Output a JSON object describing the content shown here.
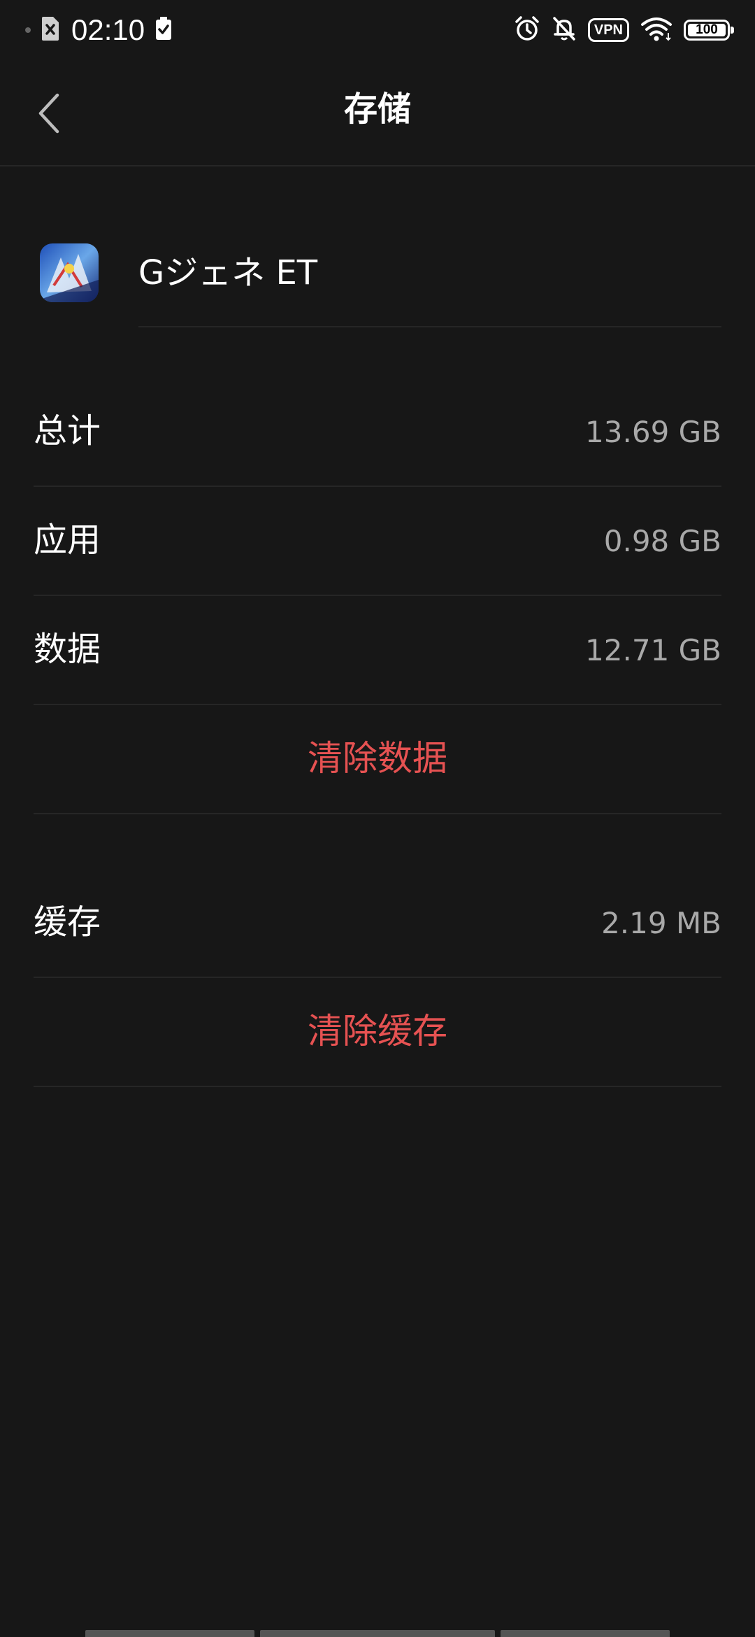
{
  "status_bar": {
    "time": "02:10",
    "vpn_label": "VPN",
    "battery_level": "100",
    "icons": [
      "sim-off-icon",
      "battery-saver-icon",
      "alarm-icon",
      "notifications-off-icon",
      "vpn-icon",
      "wifi-icon",
      "battery-icon"
    ]
  },
  "header": {
    "title": "存储",
    "back_icon": "chevron-left-icon"
  },
  "app": {
    "name": "Gジェネ ET",
    "icon": "app-icon"
  },
  "storage": {
    "total": {
      "label": "总计",
      "value": "13.69 GB"
    },
    "app": {
      "label": "应用",
      "value": "0.98 GB"
    },
    "data": {
      "label": "数据",
      "value": "12.71 GB"
    },
    "clear_data_label": "清除数据",
    "cache": {
      "label": "缓存",
      "value": "2.19 MB"
    },
    "clear_cache_label": "清除缓存"
  },
  "colors": {
    "background": "#171717",
    "text": "#ffffff",
    "secondary_text": "#a9a9a9",
    "accent_red": "#e65252",
    "divider": "#262626"
  }
}
